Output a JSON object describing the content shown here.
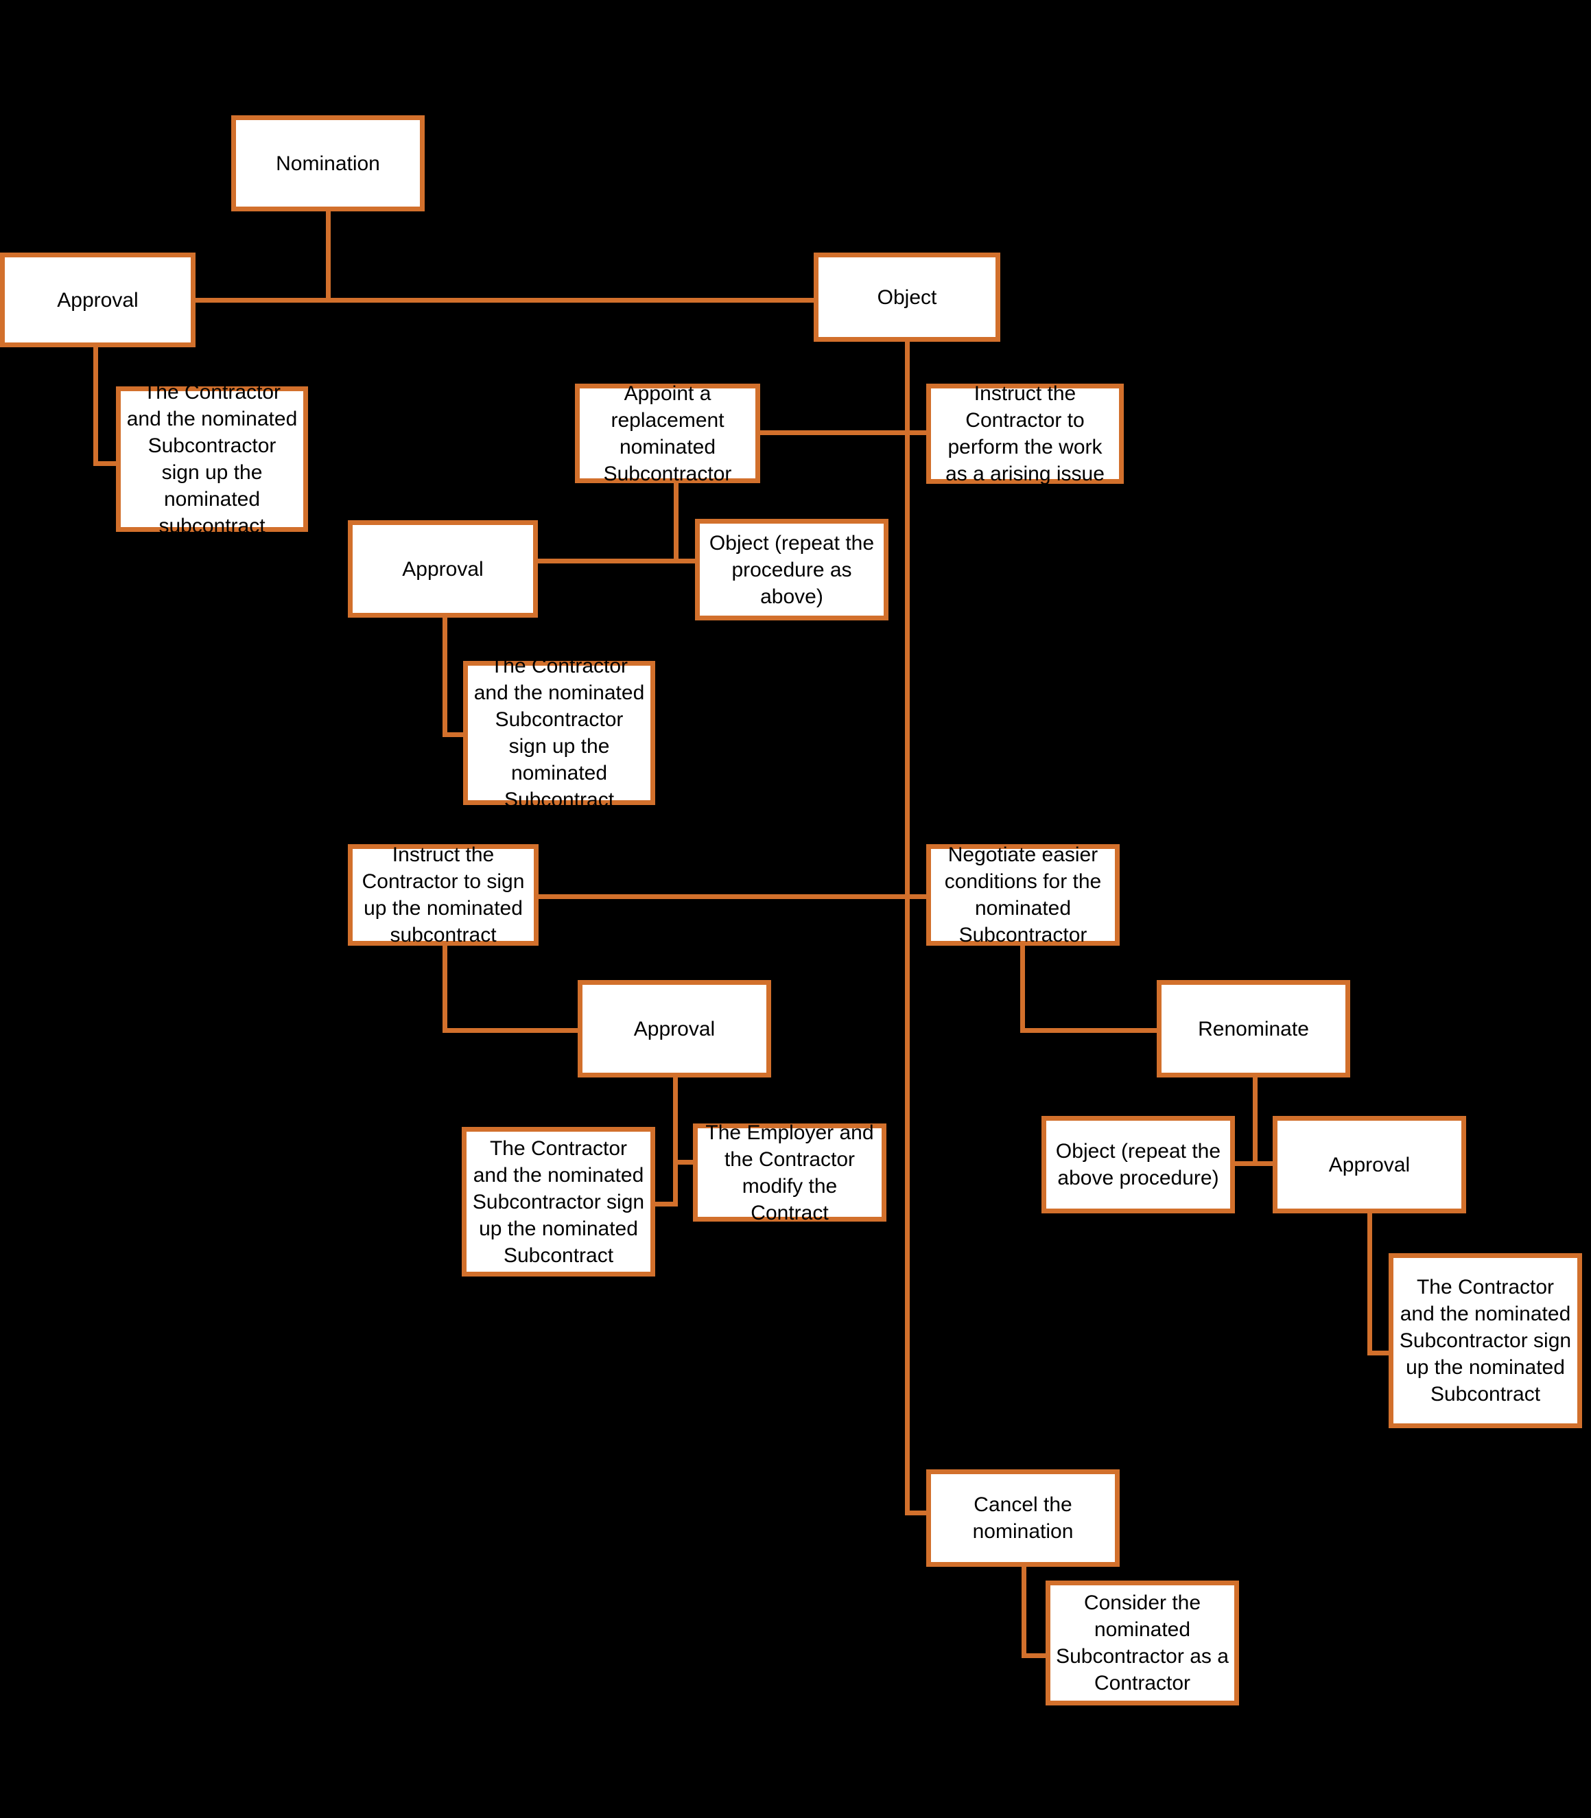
{
  "diagram": {
    "title": "Nominated Subcontractor Nomination Procedure Flowchart",
    "background_color": "#000000",
    "node_fill_color": "#ffffff",
    "node_border_color": "#D2702C",
    "connector_color": "#D2702C",
    "text_color": "#000000",
    "nodes": [
      {
        "id": "nomination",
        "label": "Nomination"
      },
      {
        "id": "approval-1",
        "label": "Approval"
      },
      {
        "id": "object-1",
        "label": "Object"
      },
      {
        "id": "sign-1",
        "label": "The Contractor and the nominated Subcontractor sign up the nominated subcontract"
      },
      {
        "id": "appoint-replacement",
        "label": "Appoint a replacement nominated Subcontractor"
      },
      {
        "id": "instruct-arising-issue",
        "label": "Instruct the Contractor to perform the work as a arising issue"
      },
      {
        "id": "approval-2",
        "label": "Approval"
      },
      {
        "id": "object-repeat-1",
        "label": "Object (repeat the procedure as above)"
      },
      {
        "id": "sign-2",
        "label": "The Contractor and the nominated Subcontractor sign up the nominated Subcontract"
      },
      {
        "id": "instruct-sign-up",
        "label": "Instruct the Contractor to sign up the nominated subcontract"
      },
      {
        "id": "negotiate-easier",
        "label": "Negotiate easier conditions for the nominated Subcontractor"
      },
      {
        "id": "approval-3",
        "label": "Approval"
      },
      {
        "id": "renominate",
        "label": "Renominate"
      },
      {
        "id": "sign-3",
        "label": "The Contractor and the nominated Subcontractor sign up the nominated Subcontract"
      },
      {
        "id": "modify-contract",
        "label": "The Employer and the Contractor modify the Contract"
      },
      {
        "id": "object-repeat-2",
        "label": "Object (repeat the above procedure)"
      },
      {
        "id": "approval-4",
        "label": "Approval"
      },
      {
        "id": "sign-4",
        "label": "The Contractor and the nominated Subcontractor sign up the nominated Subcontract"
      },
      {
        "id": "cancel-nomination",
        "label": "Cancel the nomination"
      },
      {
        "id": "consider-as-contractor",
        "label": "Consider the nominated Subcontractor as a Contractor"
      }
    ]
  }
}
